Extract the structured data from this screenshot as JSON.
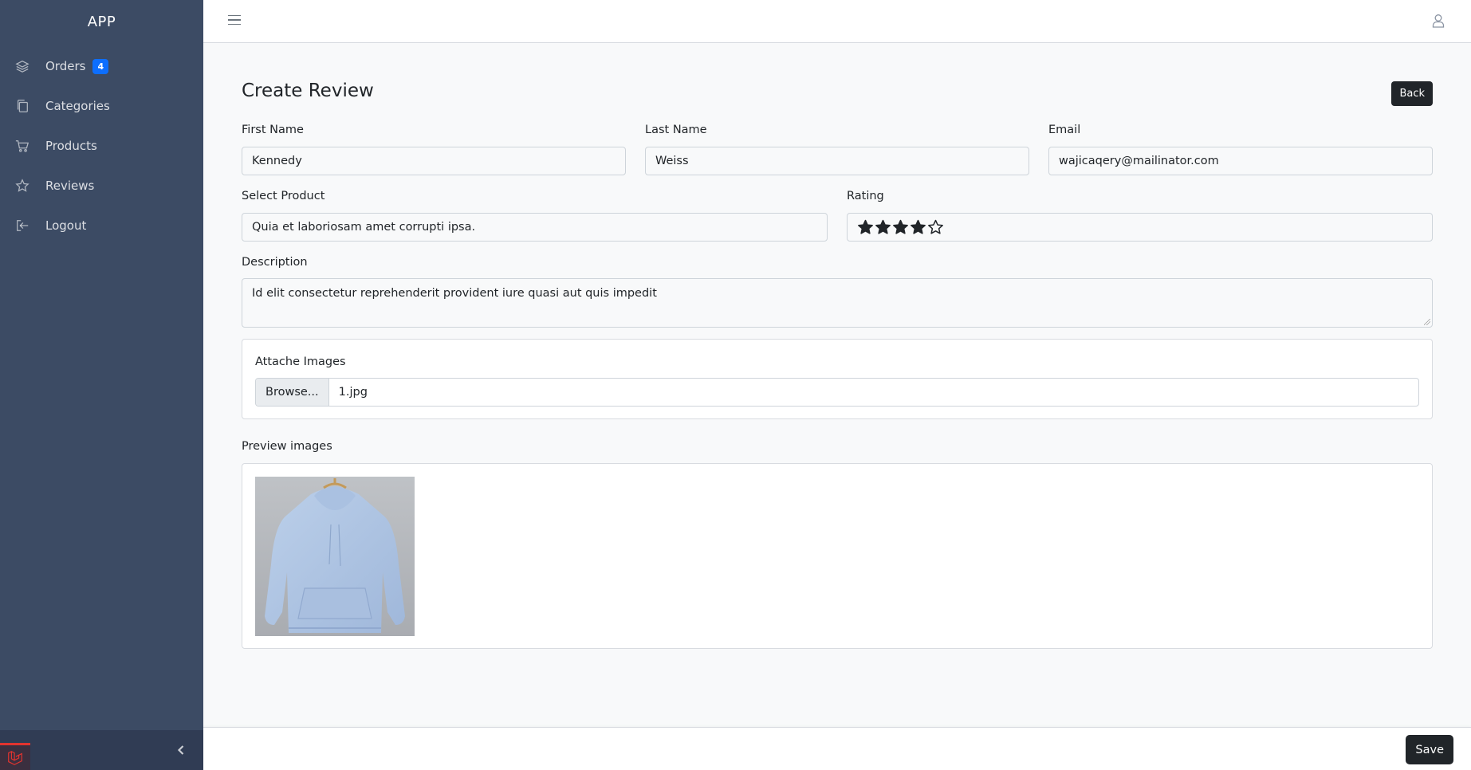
{
  "app": {
    "brand": "APP"
  },
  "sidebar": {
    "items": [
      {
        "label": "Orders",
        "icon": "layers-icon",
        "badge": "4"
      },
      {
        "label": "Categories",
        "icon": "copy-icon"
      },
      {
        "label": "Products",
        "icon": "cart-icon"
      },
      {
        "label": "Reviews",
        "icon": "star-icon"
      },
      {
        "label": "Logout",
        "icon": "logout-icon"
      }
    ]
  },
  "header": {
    "menu_icon": "hamburger-icon",
    "user_icon": "user-icon"
  },
  "page": {
    "title": "Create Review",
    "back_label": "Back"
  },
  "form": {
    "first_name": {
      "label": "First Name",
      "value": "Kennedy"
    },
    "last_name": {
      "label": "Last Name",
      "value": "Weiss"
    },
    "email": {
      "label": "Email",
      "value": "wajicaqery@mailinator.com"
    },
    "product": {
      "label": "Select Product",
      "value": "Quia et laboriosam amet corrupti ipsa."
    },
    "rating": {
      "label": "Rating",
      "value": 4,
      "max": 5
    },
    "description": {
      "label": "Description",
      "value": "Id elit consectetur reprehenderit provident iure quasi aut quis impedit"
    },
    "attach": {
      "label": "Attache Images",
      "browse_label": "Browse...",
      "file_name": "1.jpg"
    },
    "preview": {
      "label": "Preview images"
    }
  },
  "footer": {
    "save_label": "Save"
  },
  "colors": {
    "sidebar": "#3c4b64",
    "accent": "#0d6efd",
    "dark_button": "#212529"
  }
}
